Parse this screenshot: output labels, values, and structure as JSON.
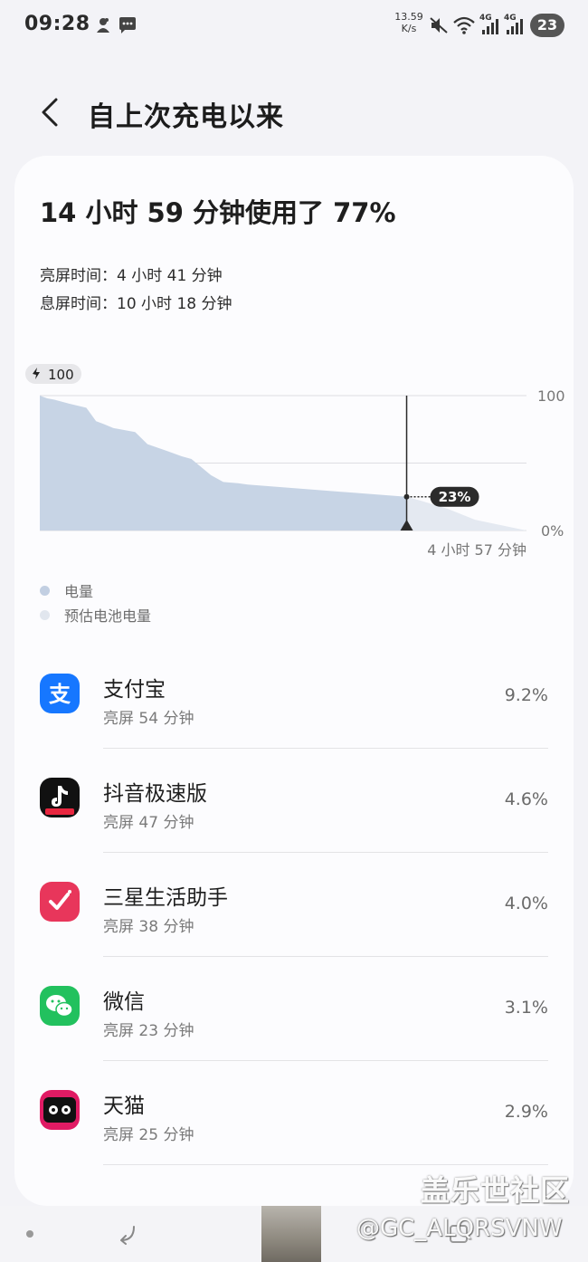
{
  "status_bar": {
    "time": "09:28",
    "speed_value": "13.59",
    "speed_unit": "K/s",
    "network_1": "4G",
    "network_2": "4G",
    "battery": "23",
    "icons": [
      "person-icon",
      "chat-bubble-icon",
      "mute-icon",
      "wifi-icon",
      "signal-icon",
      "signal-icon"
    ]
  },
  "header": {
    "title": "自上次充电以来"
  },
  "summary": {
    "headline": "14 小时 59 分钟使用了 77%",
    "screen_on_label": "亮屏时间：",
    "screen_on_value": "4 小时 41 分钟",
    "screen_off_label": "息屏时间：",
    "screen_off_value": "10 小时 18 分钟"
  },
  "chart_data": {
    "type": "area",
    "start_label": "100",
    "y_tick_top": "100",
    "y_tick_bottom": "0%",
    "current_label": "23%",
    "remaining_label": "4 小时 57 分钟",
    "ylim": [
      0,
      100
    ],
    "series": [
      {
        "name": "电量",
        "color": "#c7d4e5",
        "x_hours": [
          0,
          0.3,
          0.6,
          1.2,
          1.9,
          2.3,
          2.6,
          3.0,
          3.9,
          4.4,
          5.2,
          5.8,
          6.2,
          7.0,
          7.5,
          8.1,
          8.5,
          15.0
        ],
        "values": [
          100,
          98,
          97,
          94,
          91,
          81,
          79,
          76,
          73,
          64,
          59,
          55,
          53,
          41,
          36,
          35,
          34,
          25
        ]
      },
      {
        "name": "预估电池电量",
        "color": "#e4e9f1",
        "x_hours": [
          15.0,
          15.6,
          16.7,
          17.8,
          19.9
        ],
        "values": [
          25,
          22,
          16,
          8,
          0
        ]
      }
    ]
  },
  "legend": [
    {
      "label": "电量",
      "color": "#c2cfe2"
    },
    {
      "label": "预估电池电量",
      "color": "#e1e6ee"
    }
  ],
  "apps": [
    {
      "name": "支付宝",
      "sub": "亮屏 54 分钟",
      "pct": "9.2%",
      "icon": "alipay-icon",
      "color": "#1677ff"
    },
    {
      "name": "抖音极速版",
      "sub": "亮屏 47 分钟",
      "pct": "4.6%",
      "icon": "douyin-lite-icon",
      "color": "#111111"
    },
    {
      "name": "三星生活助手",
      "sub": "亮屏 38 分钟",
      "pct": "4.0%",
      "icon": "samsung-life-helper-icon",
      "color": "#e8365b"
    },
    {
      "name": "微信",
      "sub": "亮屏 23 分钟",
      "pct": "3.1%",
      "icon": "wechat-icon",
      "color": "#22c15e"
    },
    {
      "name": "天猫",
      "sub": "亮屏 25 分钟",
      "pct": "2.9%",
      "icon": "tmall-icon",
      "color": "#e01b64"
    }
  ],
  "watermark": {
    "brand": "盖乐世社区",
    "user": "@GC_ALQRSVNW"
  }
}
